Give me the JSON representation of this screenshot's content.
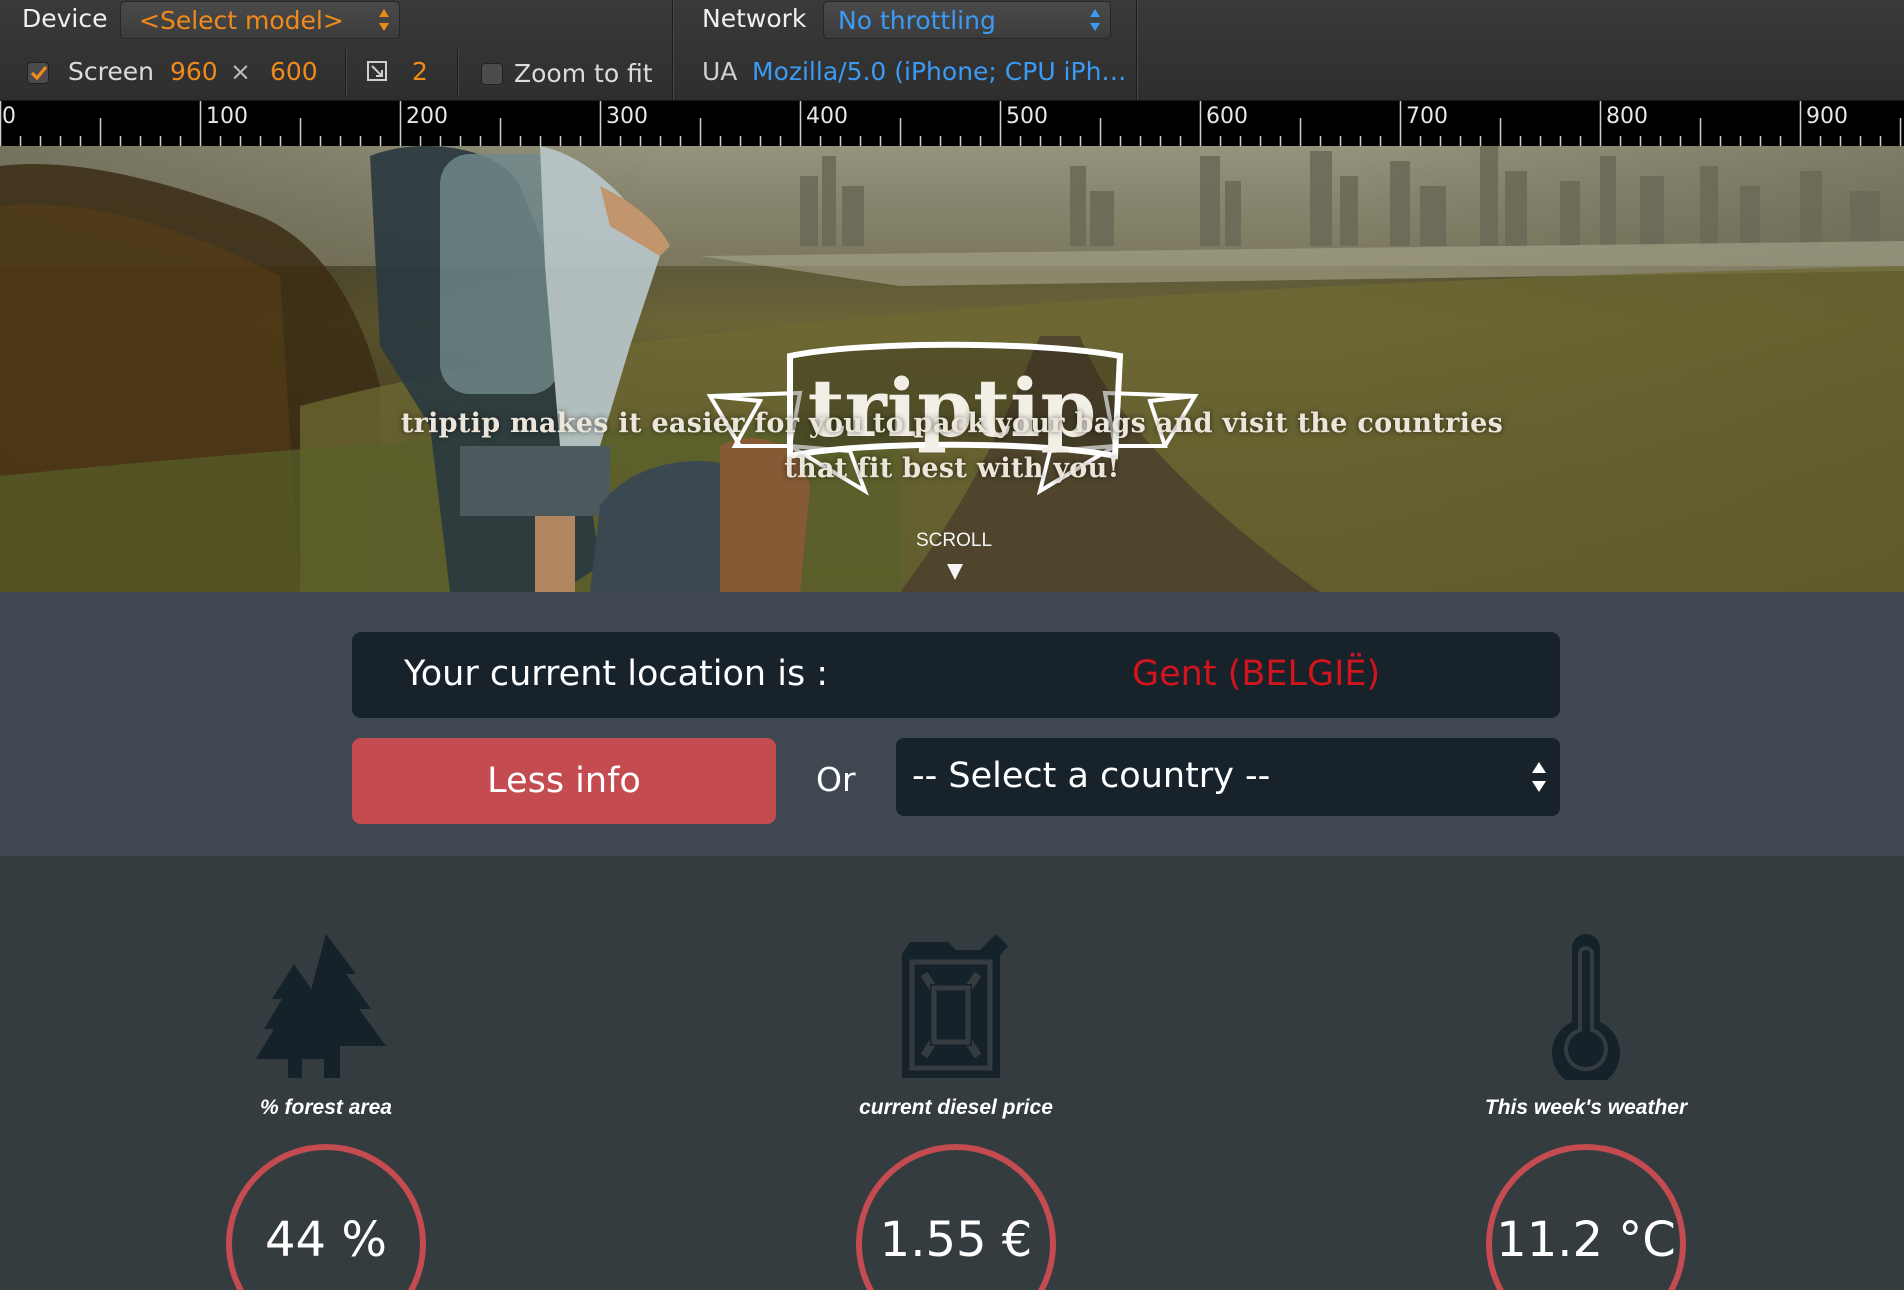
{
  "toolbar": {
    "device_label": "Device",
    "device_model": "<Select model>",
    "screen_label": "Screen",
    "screen_checked": true,
    "screen_width": "960",
    "screen_times": "×",
    "screen_height": "600",
    "pixel_ratio_icon": "device-pixel-ratio-icon",
    "pixel_ratio": "2",
    "zoom_to_fit_label": "Zoom to fit",
    "zoom_to_fit_checked": false,
    "network_label": "Network",
    "network_value": "No throttling",
    "ua_label": "UA",
    "ua_value": "Mozilla/5.0 (iPhone; CPU iPh…",
    "colors": {
      "accent_orange": "#f08a1c",
      "accent_blue": "#3b9bf4"
    }
  },
  "ruler": {
    "labels": [
      "0",
      "100",
      "200",
      "300",
      "400",
      "500",
      "600",
      "700",
      "800",
      "900"
    ]
  },
  "hero": {
    "logo_text": "triptip",
    "tagline_line1": "triptip makes it easier for you to pack your bags and visit the countries",
    "tagline_line2": "that fit best with you!",
    "scroll_label": "SCROLL"
  },
  "location": {
    "label": "Your current location is :",
    "value": "Gent (BELGIË)",
    "less_info_button": "Less info",
    "or_label": "Or",
    "country_select_placeholder": "-- Select a country --",
    "colors": {
      "value_red": "#d2141c",
      "button_red": "#c44b4f"
    }
  },
  "stats": [
    {
      "icon": "trees-icon",
      "caption": "% forest area",
      "value": "44 %"
    },
    {
      "icon": "jerrycan-icon",
      "caption": "current diesel price",
      "value": "1.55 €"
    },
    {
      "icon": "thermometer-icon",
      "caption": "This week's weather",
      "value": "11.2 °C"
    }
  ]
}
